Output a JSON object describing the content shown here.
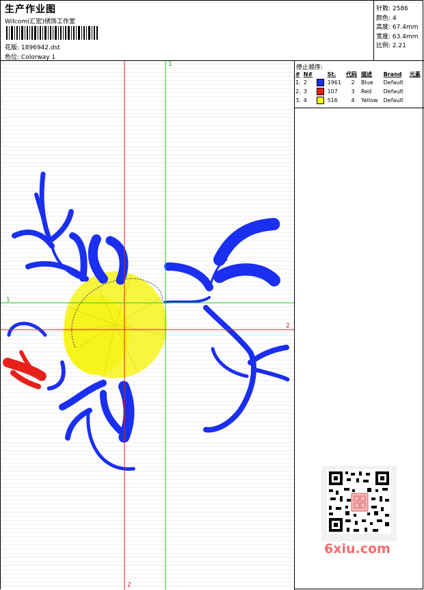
{
  "header": {
    "title": "生产作业图",
    "company": "Wilcom(汇宏)绣饰工作室",
    "design_label": "花版:",
    "design_value": "1896942.dst",
    "colorway_label": "色位:",
    "colorway_value": "Colorway 1"
  },
  "stats": [
    {
      "label": "针数:",
      "value": "2586"
    },
    {
      "label": "颜色:",
      "value": "4"
    },
    {
      "label": "高度:",
      "value": "67.4mm"
    },
    {
      "label": "宽度:",
      "value": "63.4mm"
    },
    {
      "label": "比例:",
      "value": "2.21"
    }
  ],
  "stop_sequence": {
    "title": "停止顺序:",
    "columns": [
      "#",
      "N#",
      "St.",
      "代码",
      "描述",
      "Brand",
      "元素"
    ],
    "rows": [
      {
        "idx": "1.",
        "n": "2",
        "color": "#1a2ff0",
        "st": "1961",
        "code": "2",
        "desc": "Blue",
        "brand": "Default"
      },
      {
        "idx": "2.",
        "n": "3",
        "color": "#e8201a",
        "st": "107",
        "code": "3",
        "desc": "Red",
        "brand": "Default"
      },
      {
        "idx": "3.",
        "n": "4",
        "color": "#f6f21a",
        "st": "516",
        "code": "4",
        "desc": "Yellow",
        "brand": "Default"
      }
    ]
  },
  "axes": {
    "green": "1",
    "red": "2"
  },
  "colors": {
    "blue_thread": "#1a2ff0",
    "red_thread": "#e8201a",
    "yellow_thread": "#f6f21a",
    "axis_green": "#22cc22",
    "axis_red": "#dd2222",
    "watermark": "#f36d6d"
  },
  "watermark": "6xiu.com"
}
